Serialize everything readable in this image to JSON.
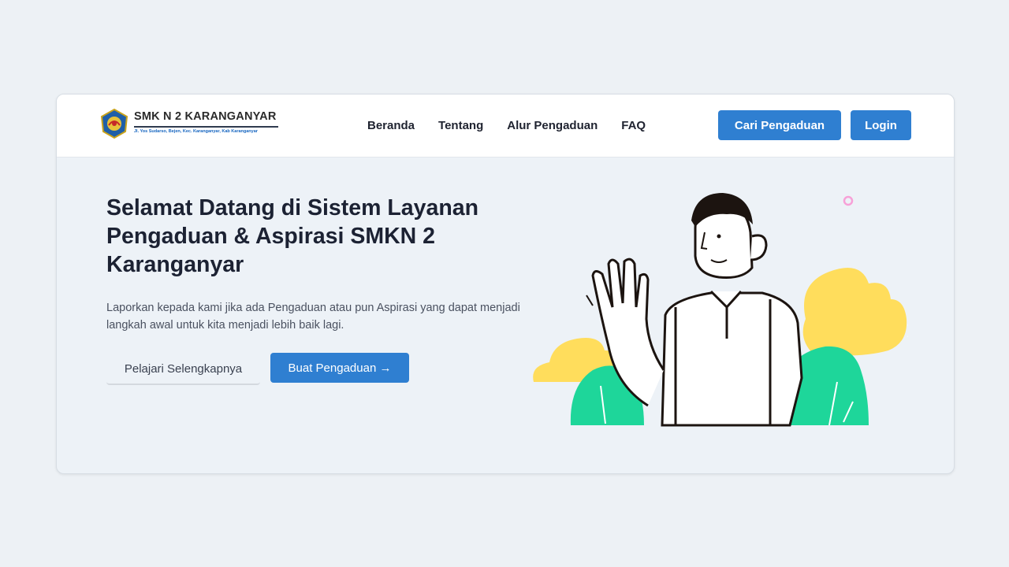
{
  "brand": {
    "name": "SMK N 2 KARANGANYAR",
    "address": "Jl. Yos Sudarso, Bejen, Kec. Karanganyar, Kab Karanganyar"
  },
  "nav": {
    "links": [
      "Beranda",
      "Tentang",
      "Alur Pengaduan",
      "FAQ"
    ],
    "search_button": "Cari Pengaduan",
    "login_button": "Login"
  },
  "hero": {
    "title": "Selamat Datang di Sistem Layanan Pengaduan & Aspirasi SMKN 2 Karanganyar",
    "description": "Laporkan kepada kami jika ada Pengaduan atau pun Aspirasi yang dapat menjadi langkah awal untuk kita menjadi lebih baik lagi.",
    "learn_more_button": "Pelajari Selengkapnya",
    "create_button": "Buat Pengaduan →"
  },
  "colors": {
    "primary": "#2f7fd1",
    "background": "#edf2f7",
    "yellow": "#ffdd5c",
    "green": "#1ed69a",
    "pink": "#f7a1d8"
  },
  "icons": {
    "logo": "school-emblem-icon",
    "illustration": "waving-student-illustration"
  }
}
